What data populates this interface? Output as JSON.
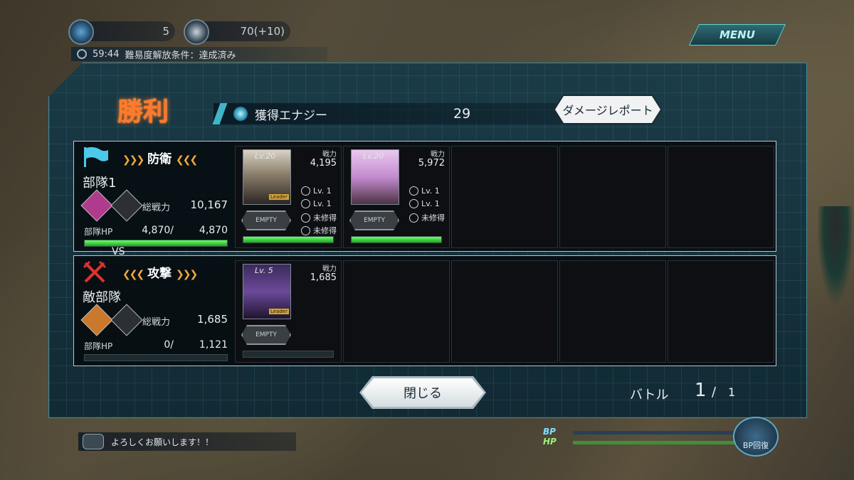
{
  "hud": {
    "stamina_value": "5",
    "ap_value": "70(+10)",
    "timer": "59:44",
    "condition": "難易度解放条件：達成済み",
    "menu_label": "MENU"
  },
  "result": {
    "title": "勝利",
    "energy_label": "獲得エナジー",
    "energy_value": "29",
    "report_button": "ダメージレポート"
  },
  "defense": {
    "side_label": "防衛",
    "unit_name": "部隊1",
    "power_label": "総戦力",
    "power_value": "10,167",
    "hp_label": "部隊HP",
    "hp_current": "4,870/",
    "hp_max": "4,870",
    "hp_fraction": 1.0,
    "rank_color": "#b03a8c",
    "slots": [
      {
        "level": "Lv.20",
        "power_label": "戦力",
        "power": "4,195",
        "stat_lv1": "Lv. 1",
        "stat_lv2": "Lv. 1",
        "stat_status": "未修得",
        "leader": "Leader",
        "empty_label": "EMPTY",
        "hp_fraction": 1.0
      },
      {
        "level": "Lv.20",
        "power_label": "戦力",
        "power": "5,972",
        "stat_lv1": "Lv. 1",
        "stat_lv2": "Lv. 1",
        "stat_status": "未修得",
        "leader": "",
        "empty_label": "EMPTY",
        "hp_fraction": 1.0
      }
    ]
  },
  "vs_label": "VS",
  "attack": {
    "side_label": "攻撃",
    "unit_name": "敵部隊",
    "power_label": "総戦力",
    "power_value": "1,685",
    "hp_label": "部隊HP",
    "hp_current": "0/",
    "hp_max": "1,121",
    "hp_fraction": 0.0,
    "rank_color": "#c9782c",
    "slots": [
      {
        "level": "Lv. 5",
        "power_label": "戦力",
        "power": "1,685",
        "leader": "Leader",
        "empty_label": "EMPTY",
        "hp_fraction": 0.0
      }
    ]
  },
  "footer": {
    "close_button": "閉じる",
    "battle_label": "バトル",
    "battle_current": "1",
    "battle_sep": "/",
    "battle_total": "1"
  },
  "chat": {
    "message": "よろしくお願いします！！"
  },
  "bp": {
    "bp_label": "BP",
    "hp_label": "HP",
    "bp_button": "BP回復"
  }
}
